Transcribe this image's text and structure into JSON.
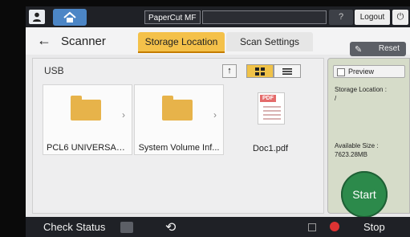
{
  "top_bar": {
    "app_badge": "PaperCut MF",
    "logout_label": "Logout",
    "help_label": "?"
  },
  "header": {
    "title": "Scanner",
    "tabs": [
      {
        "label": "Storage Location"
      },
      {
        "label": "Scan Settings"
      }
    ],
    "reset_label": "Reset"
  },
  "browser": {
    "location_label": "USB",
    "items": [
      {
        "label": "PCL6 UNIVERSAL ..."
      },
      {
        "label": "System Volume Inf..."
      },
      {
        "label": "Doc1.pdf"
      }
    ]
  },
  "side_panel": {
    "preview_label": "Preview",
    "storage_location_label": "Storage Location :",
    "storage_location_value": "/",
    "available_size_label": "Available Size :",
    "available_size_value": "7623.28MB",
    "start_label": "Start"
  },
  "bottom_bar": {
    "check_status_label": "Check Status",
    "stop_label": "Stop"
  },
  "colors": {
    "active_tab": "#f4c14a",
    "start_button": "#2c8a4b",
    "home_button": "#4c86c6"
  }
}
